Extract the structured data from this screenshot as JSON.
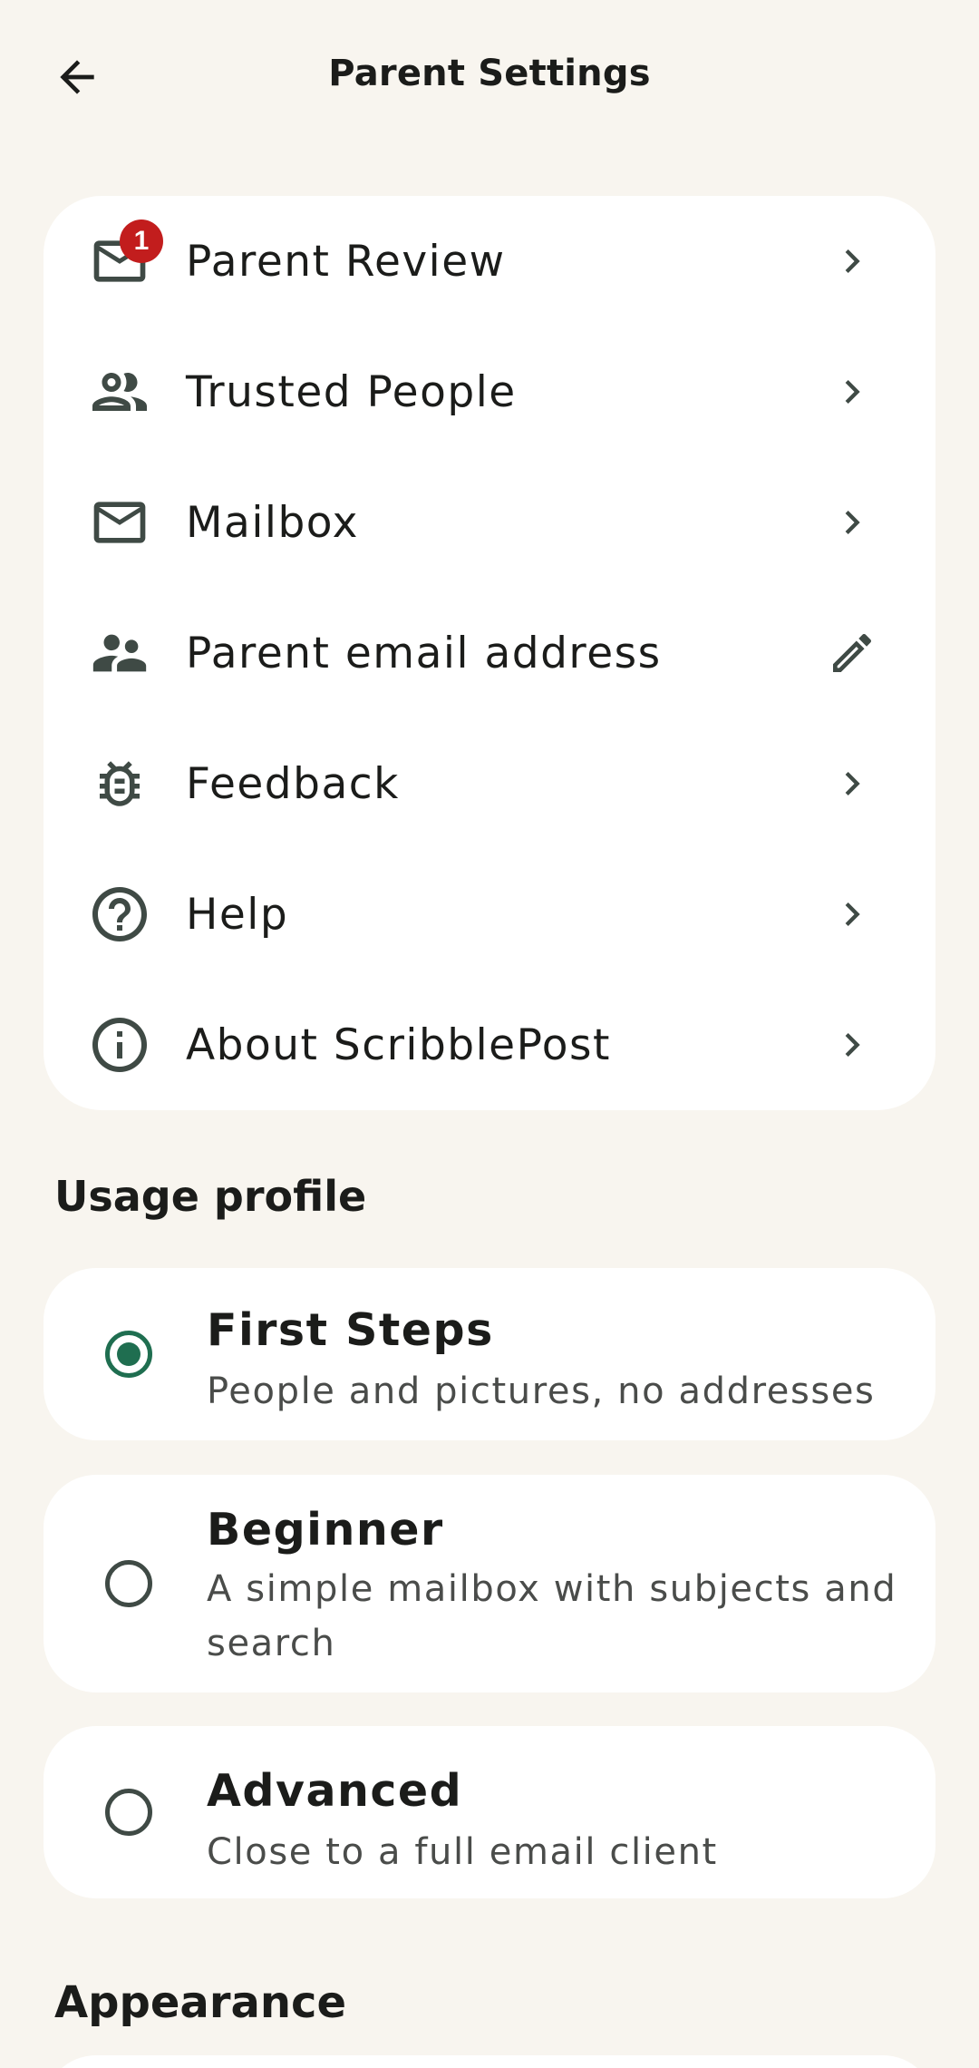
{
  "header": {
    "title": "Parent Settings"
  },
  "settings": {
    "items": [
      {
        "label": "Parent Review",
        "icon": "mail-icon",
        "badge": "1",
        "trailing": "chevron-right-icon"
      },
      {
        "label": "Trusted People",
        "icon": "people-icon",
        "trailing": "chevron-right-icon"
      },
      {
        "label": "Mailbox",
        "icon": "mail-icon",
        "trailing": "chevron-right-icon"
      },
      {
        "label": "Parent email address",
        "icon": "supervisor-account-icon",
        "trailing": "edit-pencil-icon"
      },
      {
        "label": "Feedback",
        "icon": "bug-icon",
        "trailing": "chevron-right-icon"
      },
      {
        "label": "Help",
        "icon": "help-circle-icon",
        "trailing": "chevron-right-icon"
      },
      {
        "label": "About ScribblePost",
        "icon": "info-circle-icon",
        "trailing": "chevron-right-icon"
      }
    ]
  },
  "usage_profile": {
    "title": "Usage profile",
    "selected": "First Steps",
    "options": [
      {
        "title": "First Steps",
        "description": "People and pictures, no addresses",
        "selected": true
      },
      {
        "title": "Beginner",
        "description": "A simple mailbox with subjects and search",
        "selected": false
      },
      {
        "title": "Advanced",
        "description": "Close to a full email client",
        "selected": false
      }
    ]
  },
  "appearance": {
    "title": "Appearance"
  },
  "colors": {
    "background": "#f8f5ef",
    "card": "#ffffff",
    "accent": "#1f6e50",
    "badge": "#c21d1d",
    "icon": "#3f4a45"
  }
}
